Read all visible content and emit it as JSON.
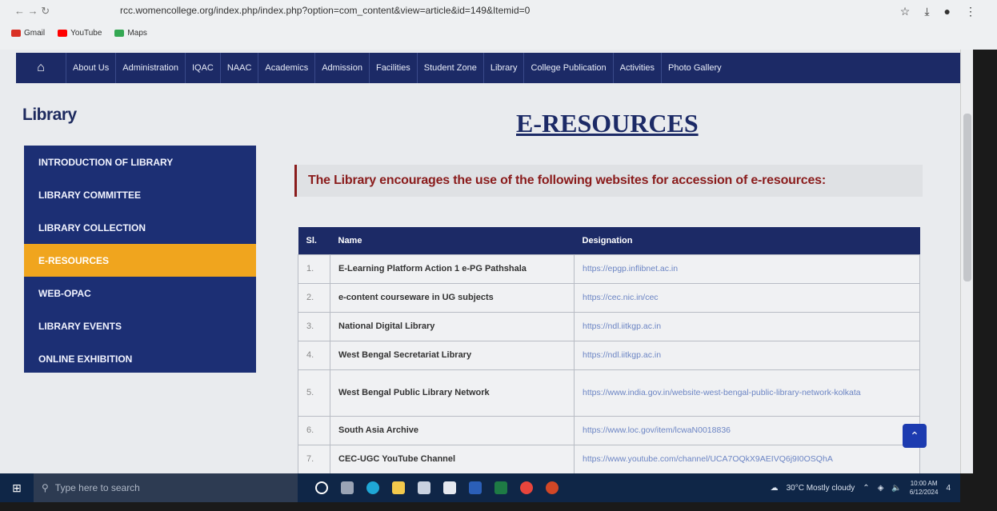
{
  "browser": {
    "url": "rcc.womencollege.org/index.php/index.php?option=com_content&view=article&id=149&Itemid=0",
    "bookmarks": [
      "Gmail",
      "YouTube",
      "Maps"
    ],
    "colors": {
      "gmail": "#d93025",
      "youtube": "#ff0000",
      "maps": "#34a853"
    }
  },
  "nav": {
    "items": [
      "About Us",
      "Administration",
      "IQAC",
      "NAAC",
      "Academics",
      "Admission",
      "Facilities",
      "Student Zone",
      "Library",
      "College Publication",
      "Activities",
      "Photo Gallery"
    ]
  },
  "sidebar": {
    "title": "Library",
    "items": [
      {
        "label": "INTRODUCTION OF LIBRARY",
        "active": false
      },
      {
        "label": "LIBRARY COMMITTEE",
        "active": false
      },
      {
        "label": "LIBRARY COLLECTION",
        "active": false
      },
      {
        "label": "E-RESOURCES",
        "active": true
      },
      {
        "label": "WEB-OPAC",
        "active": false
      },
      {
        "label": "LIBRARY EVENTS",
        "active": false
      },
      {
        "label": "ONLINE EXHIBITION",
        "active": false
      }
    ]
  },
  "main": {
    "title": "E-RESOURCES",
    "intro": "The Library encourages the use of the following websites for accession of e-resources:",
    "table": {
      "headers": [
        "Sl.",
        "Name",
        "Designation"
      ],
      "rows": [
        {
          "sl": "1.",
          "name": "E-Learning Platform Action 1 e-PG Pathshala",
          "link": "https://epgp.inflibnet.ac.in"
        },
        {
          "sl": "2.",
          "name": "e-content courseware in UG subjects",
          "link": "https://cec.nic.in/cec"
        },
        {
          "sl": "3.",
          "name": "National Digital Library",
          "link": "https://ndl.iitkgp.ac.in"
        },
        {
          "sl": "4.",
          "name": "West Bengal Secretariat Library",
          "link": "https://ndl.iitkgp.ac.in"
        },
        {
          "sl": "5.",
          "name": "West Bengal Public Library Network",
          "link": "https://www.india.gov.in/website-west-bengal-public-library-network-kolkata"
        },
        {
          "sl": "6.",
          "name": "South Asia Archive",
          "link": "https://www.loc.gov/item/lcwaN0018836"
        },
        {
          "sl": "7.",
          "name": "CEC-UGC YouTube Channel",
          "link": "https://www.youtube.com/channel/UCA7OQkX9AEIVQ6j9I0OSQhA"
        }
      ]
    }
  },
  "taskbar": {
    "search_placeholder": "Type here to search",
    "weather": "30°C  Mostly cloudy",
    "time": "10:00 AM",
    "date": "6/12/2024",
    "notifications": "4"
  }
}
